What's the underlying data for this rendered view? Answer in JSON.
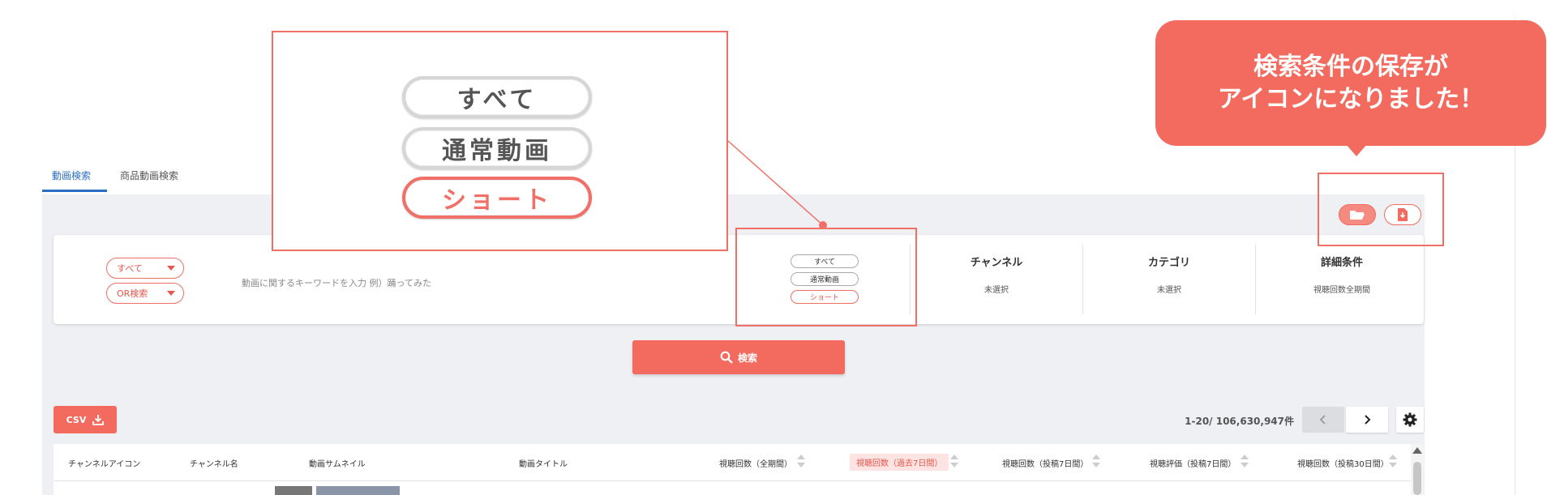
{
  "tabs": [
    {
      "label": "動画検索",
      "active": true
    },
    {
      "label": "商品動画検索",
      "active": false
    }
  ],
  "search": {
    "type_select": "すべて",
    "mode_select": "OR検索",
    "keyword_placeholder": "動画に関するキーワードを入力 例）踊ってみた",
    "video_types": [
      "すべて",
      "通常動画",
      "ショート"
    ],
    "video_type_selected": "ショート",
    "filters": [
      {
        "title": "チャンネル",
        "value": "未選択"
      },
      {
        "title": "カテゴリ",
        "value": "未選択"
      },
      {
        "title": "詳細条件",
        "value": "視聴回数全期間"
      }
    ],
    "search_button": "検索"
  },
  "toolbar": {
    "csv_button": "CSV",
    "result_count": "1-20/ 106,630,947件"
  },
  "table": {
    "columns": [
      "チャンネルアイコン",
      "チャンネル名",
      "動画サムネイル",
      "動画タイトル",
      "視聴回数（全期間）",
      "視聴回数（過去7日間）",
      "視聴回数（投稿7日間）",
      "視聴評価（投稿7日間）",
      "視聴回数（投稿30日間）"
    ],
    "sorted_column": "視聴回数（過去7日間）"
  },
  "callout": {
    "zoom_buttons": [
      "すべて",
      "通常動画",
      "ショート"
    ],
    "bubble_line1": "検索条件の保存が",
    "bubble_line2": "アイコンになりました！"
  },
  "colors": {
    "accent": "#f26b5e",
    "tab_active": "#2b6fc4",
    "panel_bg": "#eef0f4"
  },
  "icons": [
    "chevron-down-icon",
    "folder-open-icon",
    "file-download-icon",
    "search-icon",
    "download-icon",
    "chevron-left-icon",
    "chevron-right-icon",
    "gear-icon",
    "sort-icon"
  ]
}
